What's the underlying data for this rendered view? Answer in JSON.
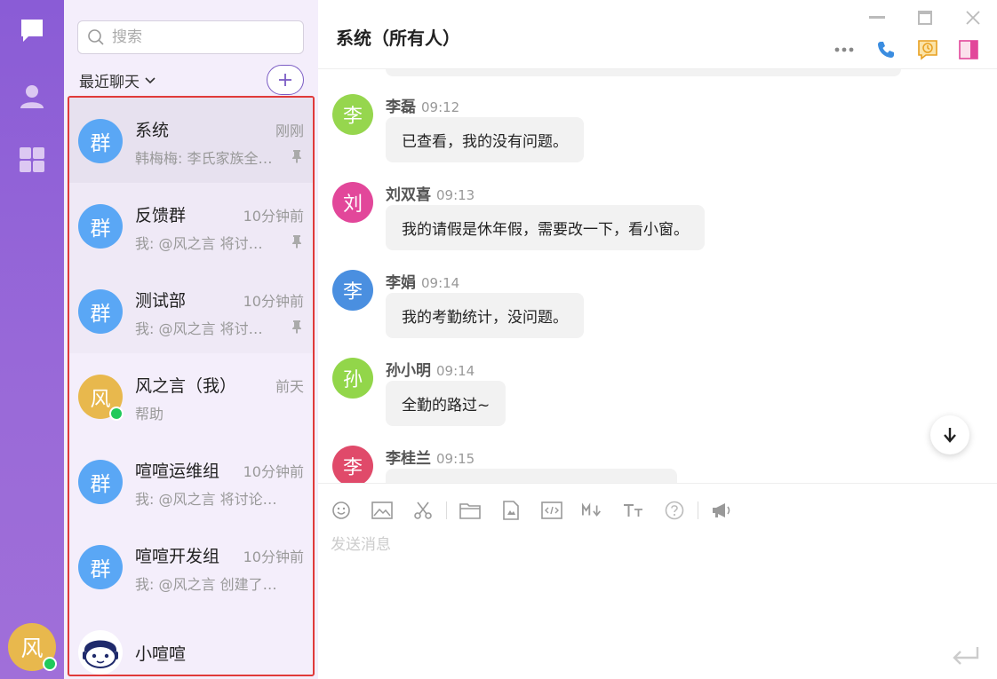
{
  "colors": {
    "accent": "#7b5cc4",
    "online": "#20c95b",
    "group_avatar": "#5aa7f5",
    "highlight_border": "#e03a3a"
  },
  "rail": {
    "user_avatar_text": "风"
  },
  "list": {
    "search_placeholder": "搜索",
    "recent_label": "最近聊天",
    "items": [
      {
        "avatar": "群",
        "name": "系统",
        "time": "刚刚",
        "preview": "韩梅梅: 李氏家族全…",
        "pinned": true
      },
      {
        "avatar": "群",
        "name": "反馈群",
        "time": "10分钟前",
        "preview": "我: @风之言 将讨…",
        "pinned": true
      },
      {
        "avatar": "群",
        "name": "测试部",
        "time": "10分钟前",
        "preview": "我: @风之言 将讨…",
        "pinned": true
      },
      {
        "avatar": "风",
        "name": "风之言（我）",
        "time": "前天",
        "preview": "帮助",
        "pinned": false
      },
      {
        "avatar": "群",
        "name": "喧喧运维组",
        "time": "10分钟前",
        "preview": "我: @风之言 将讨论…",
        "pinned": false
      },
      {
        "avatar": "群",
        "name": "喧喧开发组",
        "time": "10分钟前",
        "preview": "我: @风之言 创建了…",
        "pinned": false
      },
      {
        "avatar": "",
        "name": "小喧喧",
        "time": "",
        "preview": "",
        "pinned": false
      }
    ]
  },
  "conversation": {
    "title": "系统（所有人）",
    "messages": [
      {
        "avatar": "李",
        "avatar_color": "#96d64e",
        "sender": "李磊",
        "time": "09:12",
        "text": "已查看，我的没有问题。"
      },
      {
        "avatar": "刘",
        "avatar_color": "#e2479a",
        "sender": "刘双喜",
        "time": "09:13",
        "text": "我的请假是休年假，需要改一下，看小窗。"
      },
      {
        "avatar": "李",
        "avatar_color": "#4a8fe0",
        "sender": "李娟",
        "time": "09:14",
        "text": "我的考勤统计，没问题。"
      },
      {
        "avatar": "孙",
        "avatar_color": "#92d64a",
        "sender": "孙小明",
        "time": "09:14",
        "text": "全勤的路过~"
      },
      {
        "avatar": "李",
        "avatar_color": "#e04a6a",
        "sender": "李桂兰",
        "time": "09:15",
        "text": ""
      }
    ],
    "composer_placeholder": "发送消息"
  }
}
